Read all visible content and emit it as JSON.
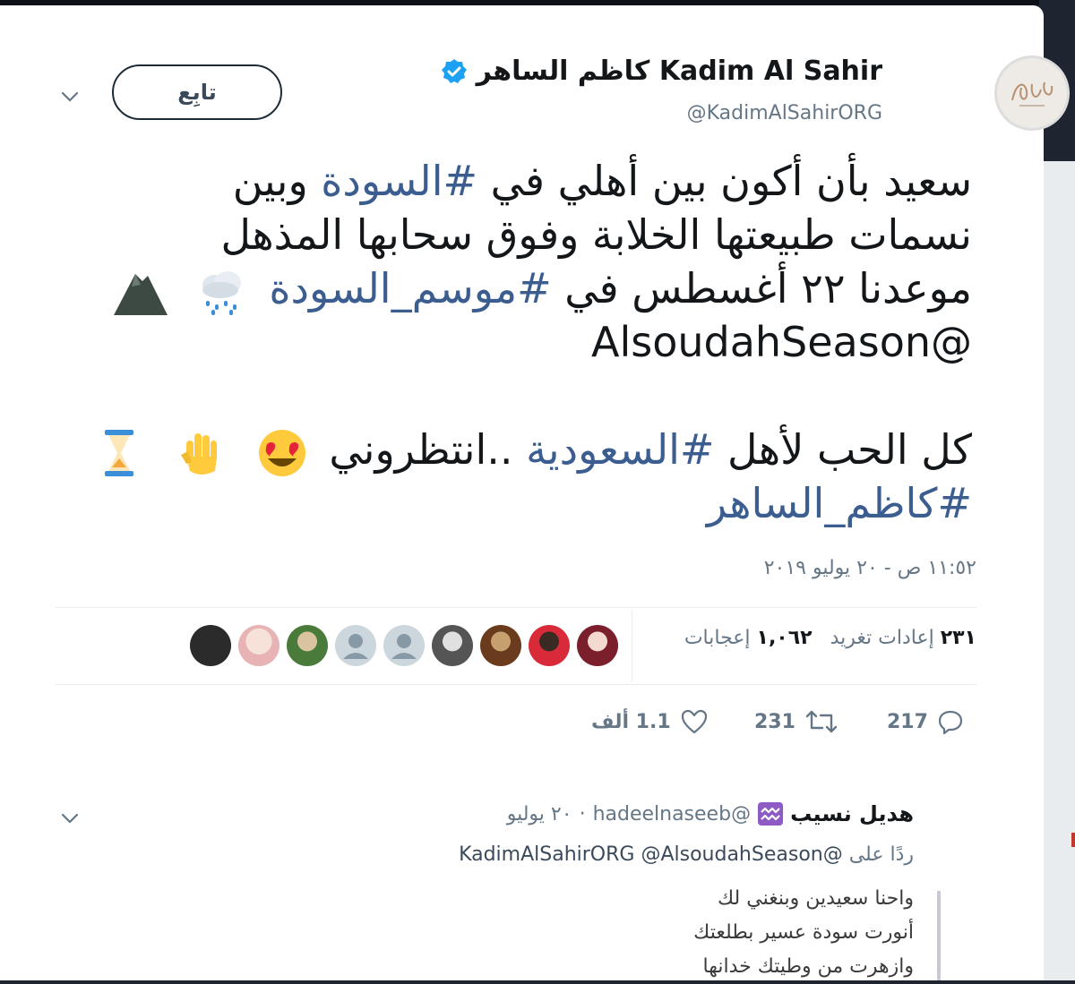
{
  "profile": {
    "display_name": "Kadim Al Sahir كاظم الساهر",
    "handle": "@KadimAlSahirORG",
    "follow_label": "تابِع",
    "avatar_icon": "kadim-logo-avatar",
    "verified_color": "#1da1f2"
  },
  "tweet": {
    "l1_a": "سعيد بأن أكون بين أهلي في ",
    "l1_tag": "#السودة",
    "l1_b": " وبين",
    "l2": "نسمات طبيعتها الخلابة وفوق سحابها المذهل",
    "l3_a": "موعدنا ٢٢ أغسطس في ",
    "l3_tag": "#موسم_السودة",
    "l4_mention": "@AlsoudahSeason",
    "l5_a": "كل الحب لأهل ",
    "l5_tag": "#السعودية",
    "l5_b": " ..انتظروني",
    "l6_tag": "#كاظم_الساهر",
    "emojis": [
      "rain-cloud-icon",
      "mountain-icon",
      "heart-eyes-icon",
      "raised-hand-icon",
      "hourglass-icon"
    ],
    "tag_color": "#3b5d8f",
    "timestamp": "١١:٥٢ ص - ٢٠ يوليو ٢٠١٩"
  },
  "stats": {
    "retweets_count": "٢٣١",
    "retweets_label": "إعادات تغريد",
    "likes_count": "١,٠٦٢",
    "likes_label": "إعجابات"
  },
  "actions": {
    "reply_count": "217",
    "retweet_count": "231",
    "like_count": "1.1 ألف"
  },
  "reply": {
    "name": "هديل نسيب",
    "handle": "@hadeelnaseeb",
    "date": "٢٠ يوليو",
    "replying_prefix": "ردًا على",
    "replying_to_1": "@KadimAlSahirORG",
    "replying_to_2": "@AlsoudahSeason",
    "lines": [
      "واحنا سعيدين وبنغني لك",
      "أنورت سودة عسير بطلعتك",
      "وازهرت من وطيتك خدانها"
    ]
  }
}
